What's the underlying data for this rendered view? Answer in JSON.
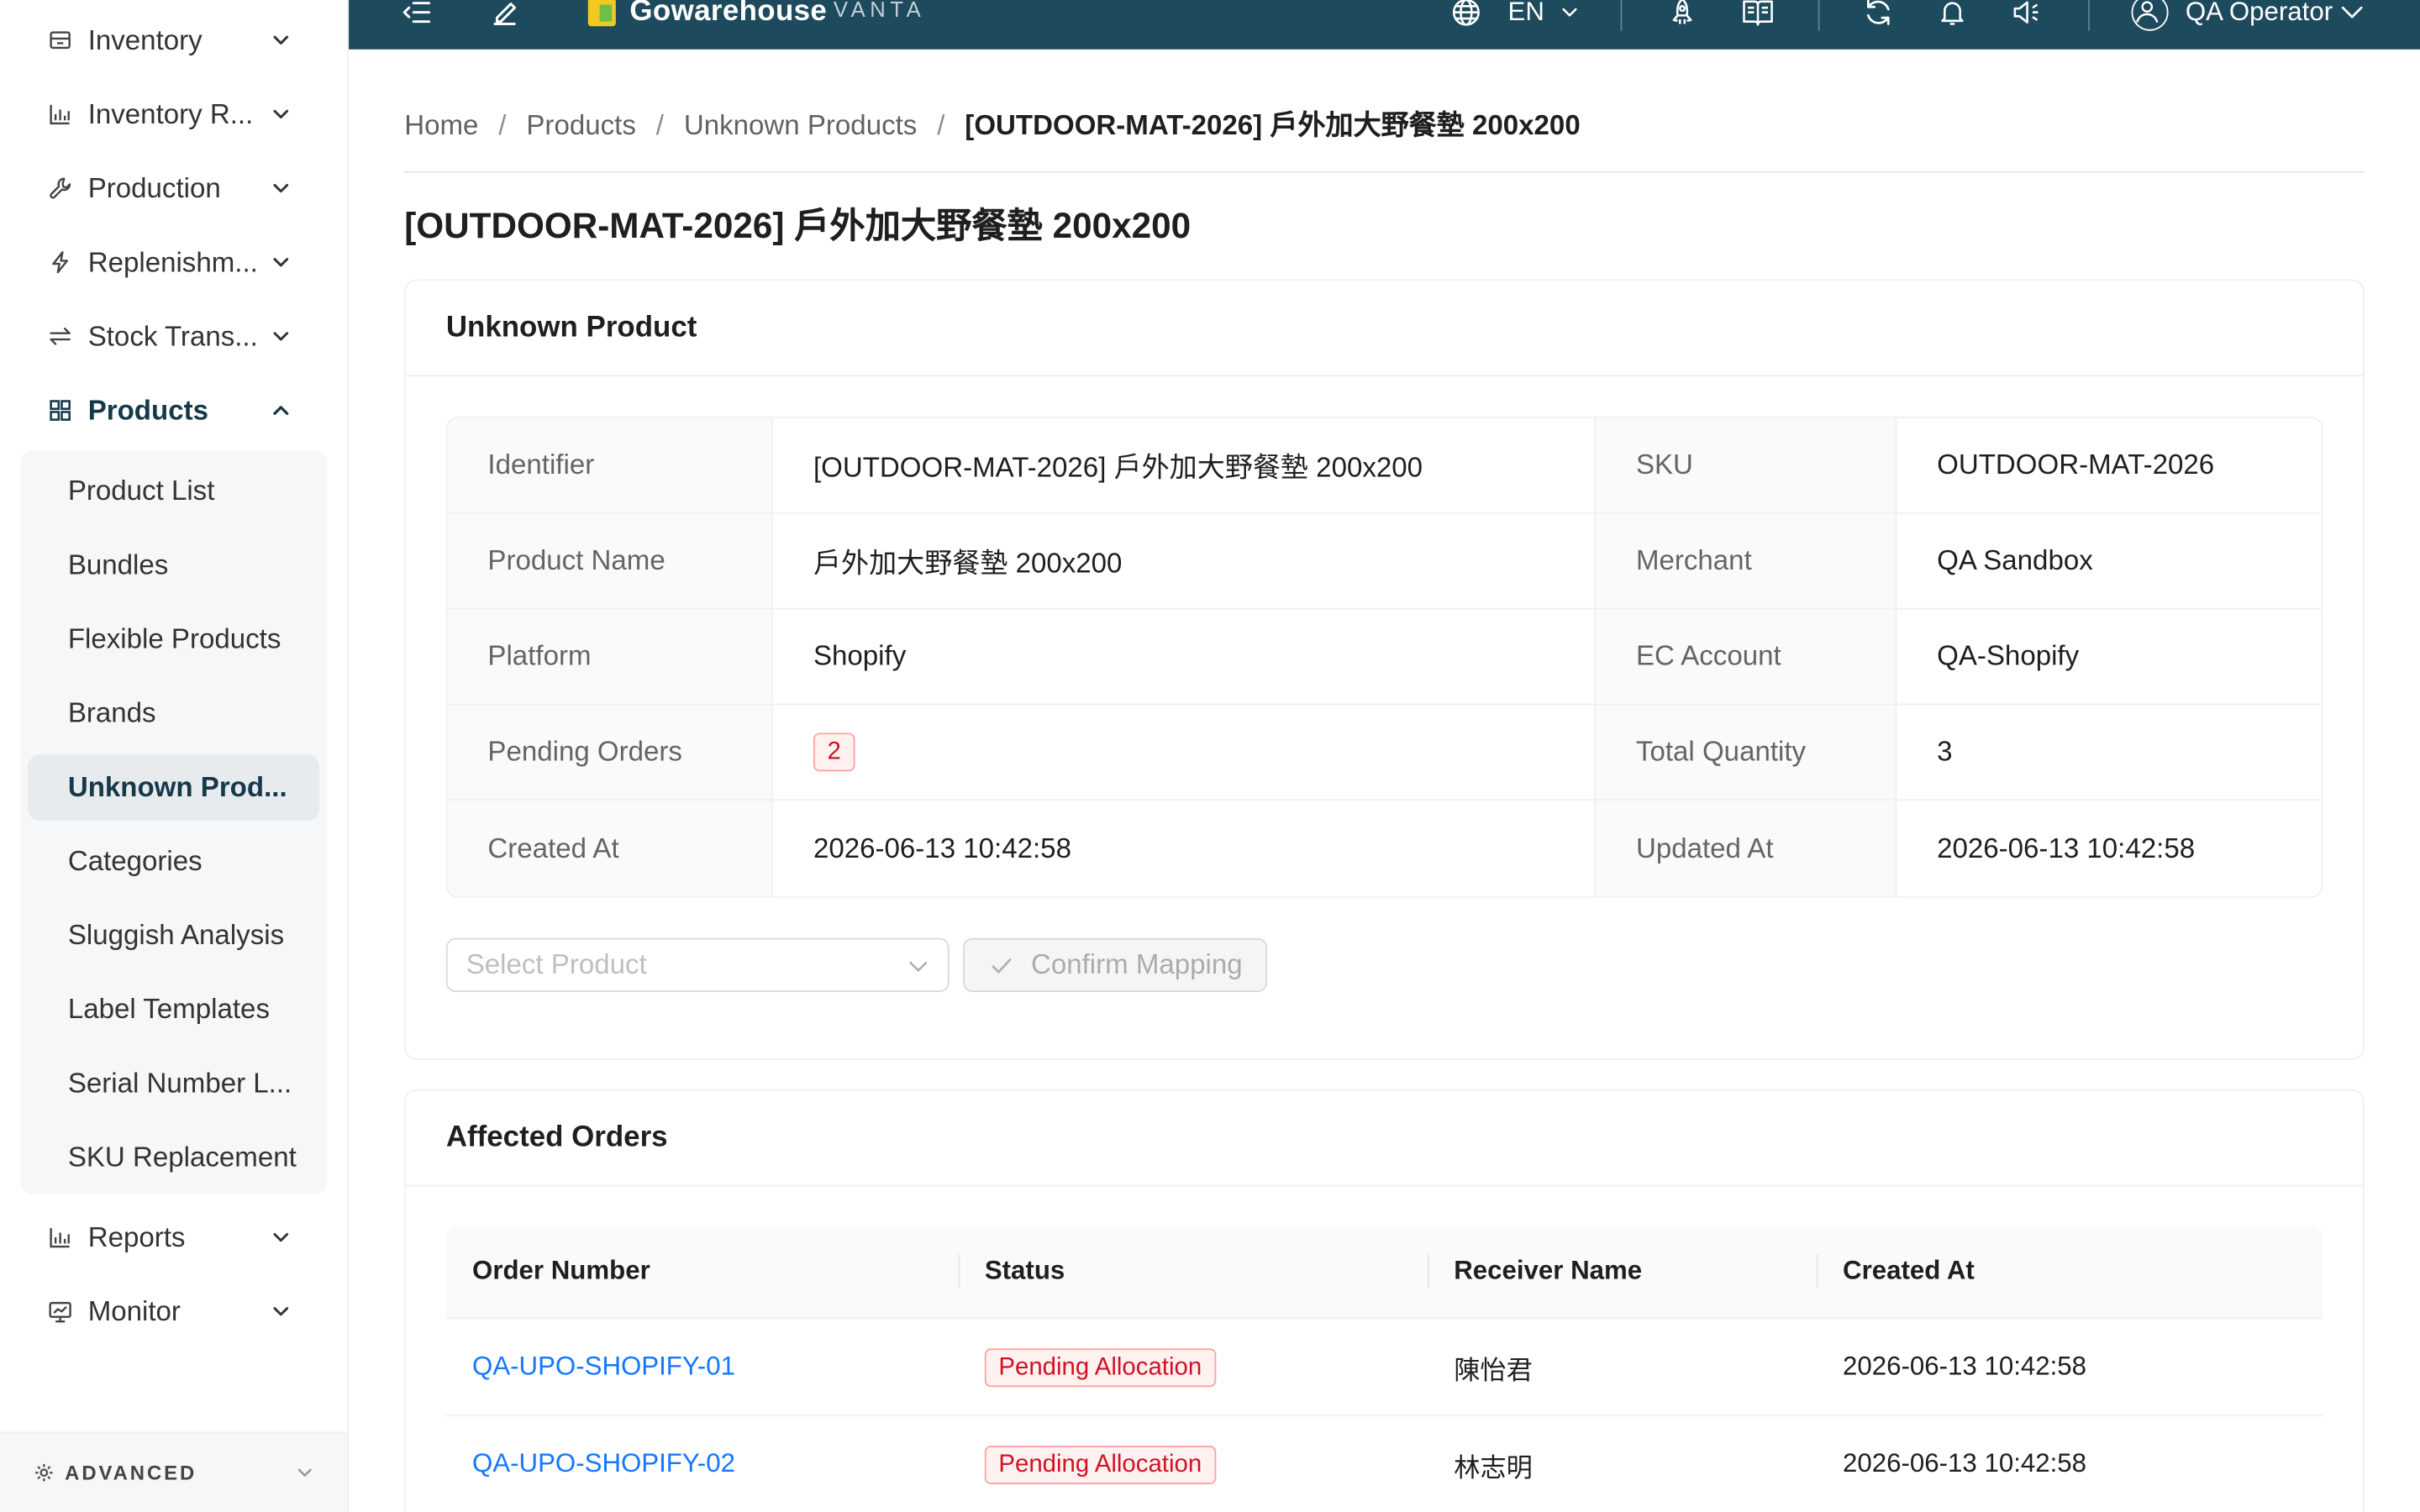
{
  "colors": {
    "header_background": "#1d4a5d",
    "active_menu": "#16394a",
    "link": "#1677ff",
    "tag_red": "#cf1322"
  },
  "header": {
    "logo_text": "Gowarehouse",
    "logo_tagline": "VANTA",
    "language": "EN",
    "user_name": "QA Operator"
  },
  "sidebar": {
    "items": [
      {
        "label": "Inventory",
        "icon": "inbox-icon",
        "expanded": false
      },
      {
        "label": "Inventory R...",
        "icon": "bar-chart-icon",
        "expanded": false
      },
      {
        "label": "Production",
        "icon": "tool-icon",
        "expanded": false
      },
      {
        "label": "Replenishm...",
        "icon": "thunderbolt-icon",
        "expanded": false
      },
      {
        "label": "Stock Trans...",
        "icon": "swap-icon",
        "expanded": false
      },
      {
        "label": "Products",
        "icon": "appstore-icon",
        "expanded": true
      },
      {
        "label": "Reports",
        "icon": "bar-chart-icon",
        "expanded": false
      },
      {
        "label": "Monitor",
        "icon": "monitor-icon",
        "expanded": false
      }
    ],
    "products_submenu": [
      {
        "label": "Product List",
        "selected": false
      },
      {
        "label": "Bundles",
        "selected": false
      },
      {
        "label": "Flexible Products",
        "selected": false
      },
      {
        "label": "Brands",
        "selected": false
      },
      {
        "label": "Unknown Prod...",
        "selected": true
      },
      {
        "label": "Categories",
        "selected": false
      },
      {
        "label": "Sluggish Analysis",
        "selected": false
      },
      {
        "label": "Label Templates",
        "selected": false
      },
      {
        "label": "Serial Number L...",
        "selected": false
      },
      {
        "label": "SKU Replacement",
        "selected": false
      }
    ],
    "advanced_label": "ADVANCED"
  },
  "breadcrumb": {
    "separator": "/",
    "items": [
      "Home",
      "Products",
      "Unknown Products",
      "[OUTDOOR-MAT-2026] 戶外加大野餐墊 200x200"
    ]
  },
  "page_title": "[OUTDOOR-MAT-2026] 戶外加大野餐墊 200x200",
  "unknown_product": {
    "title": "Unknown Product",
    "rows": [
      {
        "label1": "Identifier",
        "value1": "[OUTDOOR-MAT-2026] 戶外加大野餐墊 200x200",
        "label2": "SKU",
        "value2": "OUTDOOR-MAT-2026"
      },
      {
        "label1": "Product Name",
        "value1": "戶外加大野餐墊 200x200",
        "label2": "Merchant",
        "value2": "QA Sandbox"
      },
      {
        "label1": "Platform",
        "value1": "Shopify",
        "label2": "EC Account",
        "value2": "QA-Shopify"
      },
      {
        "label1": "Pending Orders",
        "value1": "2",
        "label2": "Total Quantity",
        "value2": "3"
      },
      {
        "label1": "Created At",
        "value1": "2026-06-13 10:42:58",
        "label2": "Updated At",
        "value2": "2026-06-13 10:42:58"
      }
    ],
    "select_placeholder": "Select Product",
    "confirm_label": "Confirm Mapping",
    "confirm_disabled": true
  },
  "affected_orders": {
    "title": "Affected Orders",
    "columns": [
      "Order Number",
      "Status",
      "Receiver Name",
      "Created At"
    ],
    "rows": [
      {
        "order_number": "QA-UPO-SHOPIFY-01",
        "status": "Pending Allocation",
        "receiver": "陳怡君",
        "created_at": "2026-06-13 10:42:58"
      },
      {
        "order_number": "QA-UPO-SHOPIFY-02",
        "status": "Pending Allocation",
        "receiver": "林志明",
        "created_at": "2026-06-13 10:42:58"
      }
    ]
  }
}
